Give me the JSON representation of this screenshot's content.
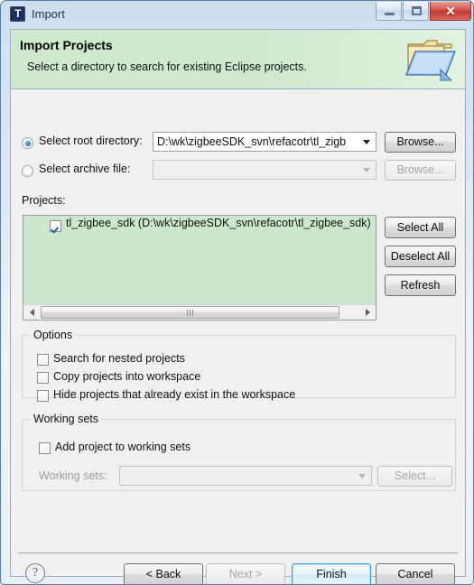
{
  "window": {
    "title": "Import",
    "icon": "telink-t-icon",
    "controls": {
      "minimize": "minimize-icon",
      "maximize": "restore-icon",
      "close": "✕"
    }
  },
  "banner": {
    "title": "Import Projects",
    "subtitle": "Select a directory to search for existing Eclipse projects.",
    "icon": "open-folder-icon",
    "background": "#cde9ce"
  },
  "source": {
    "root_directory": {
      "label": "Select root directory:",
      "selected": true,
      "value": "D:\\wk\\zigbeeSDK_svn\\refacotr\\tl_zigb",
      "browse_label": "Browse...",
      "browse_enabled": true
    },
    "archive_file": {
      "label": "Select archive file:",
      "selected": false,
      "value": "",
      "browse_label": "Browse...",
      "browse_enabled": false
    }
  },
  "projects": {
    "label": "Projects:",
    "background": "#cce8cc",
    "items": [
      {
        "checked": true,
        "text": "tl_zigbee_sdk (D:\\wk\\zigbeeSDK_svn\\refacotr\\tl_zigbee_sdk)"
      }
    ],
    "buttons": [
      {
        "label": "Select All",
        "enabled": true
      },
      {
        "label": "Deselect All",
        "enabled": true
      },
      {
        "label": "Refresh",
        "enabled": true
      }
    ]
  },
  "options": {
    "title": "Options",
    "items": [
      {
        "label": "Search for nested projects",
        "checked": false
      },
      {
        "label": "Copy projects into workspace",
        "checked": false
      },
      {
        "label": "Hide projects that already exist in the workspace",
        "checked": false
      }
    ]
  },
  "working_sets": {
    "title": "Working sets",
    "add_checkbox": {
      "label": "Add project to working sets",
      "checked": false
    },
    "field_label": "Working sets:",
    "field_value": "",
    "field_enabled": false,
    "select_label": "Select...",
    "select_enabled": false
  },
  "footer": {
    "help": "?",
    "buttons": [
      {
        "label": "< Back",
        "enabled": true,
        "default": false
      },
      {
        "label": "Next >",
        "enabled": false,
        "default": false
      },
      {
        "label": "Finish",
        "enabled": true,
        "default": true
      },
      {
        "label": "Cancel",
        "enabled": true,
        "default": false
      }
    ]
  }
}
